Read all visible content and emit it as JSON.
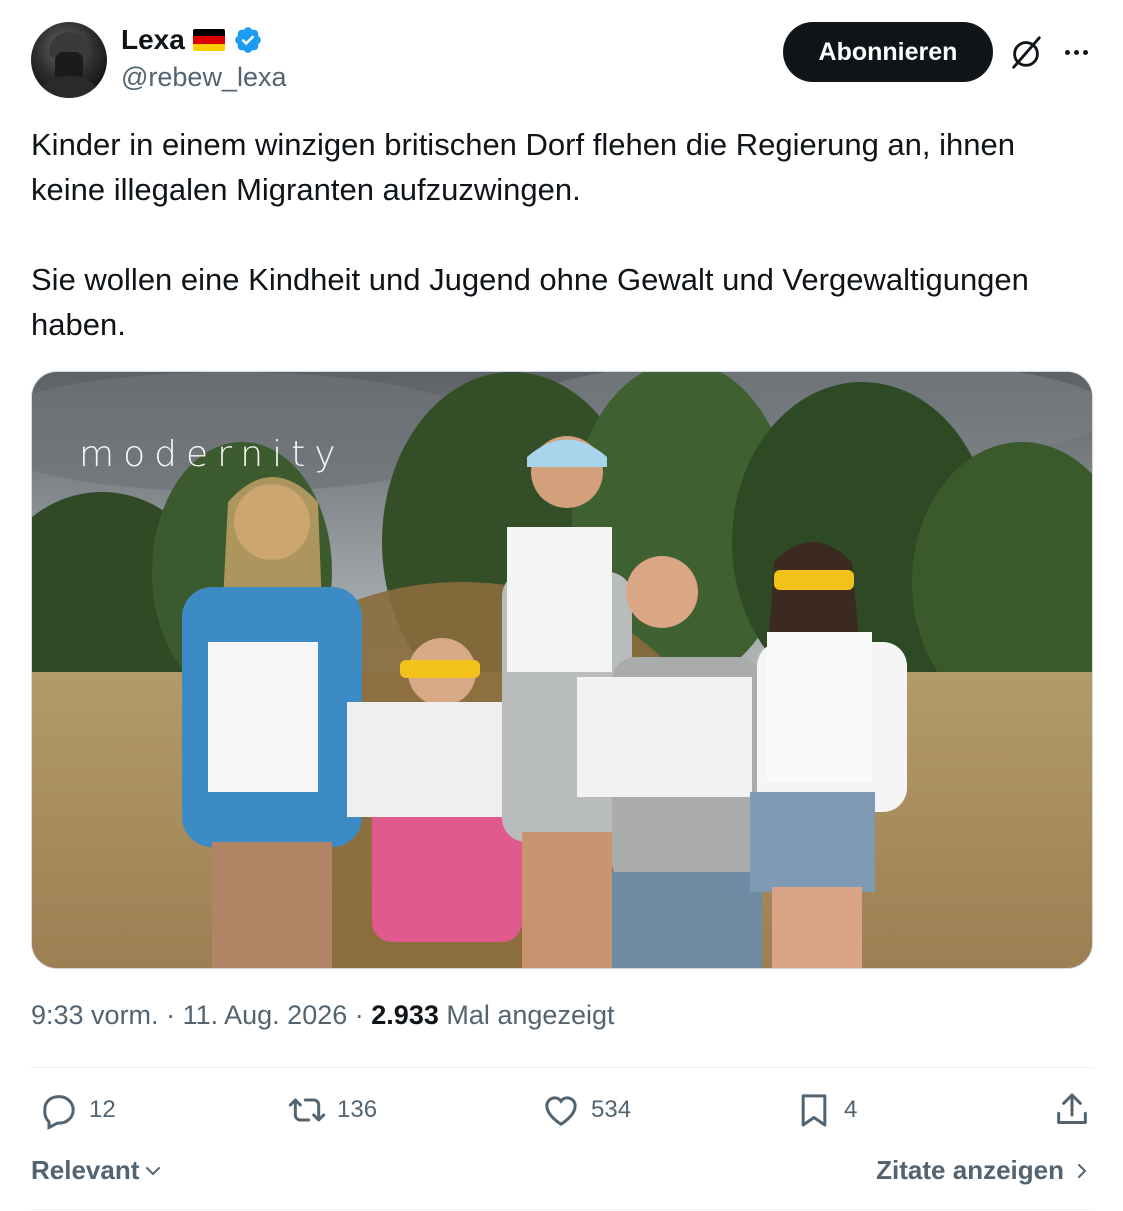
{
  "user": {
    "name": "Lexa",
    "handle": "@rebew_lexa",
    "flag_icon": "germany-flag-icon",
    "verified_icon": "verified-badge-icon",
    "verified_color": "#1d9bf0"
  },
  "header": {
    "follow_label": "Abonnieren",
    "grok_icon": "grok-icon",
    "more_icon": "more-options-icon"
  },
  "tweet": {
    "paragraph_1": "Kinder in einem winzigen britischen Dorf flehen die Regierung an, ihnen keine illegalen Migranten aufzuzwingen.",
    "paragraph_2": "Sie wollen eine Kindheit und Jugend ohne Gewalt und Vergewaltigungen haben."
  },
  "media": {
    "watermark": "modernity"
  },
  "meta": {
    "time": "9:33 vorm.",
    "separator": "·",
    "date": "11. Aug. 2026",
    "views_count": "2.933",
    "views_label": "Mal angezeigt"
  },
  "actions": {
    "replies": "12",
    "reposts": "136",
    "likes": "534",
    "bookmarks": "4"
  },
  "footer": {
    "sort_label": "Relevant",
    "quotes_label": "Zitate anzeigen"
  },
  "colors": {
    "text": "#0f1419",
    "secondary": "#536471",
    "border": "#eff3f4",
    "button_bg": "#0f1419"
  }
}
